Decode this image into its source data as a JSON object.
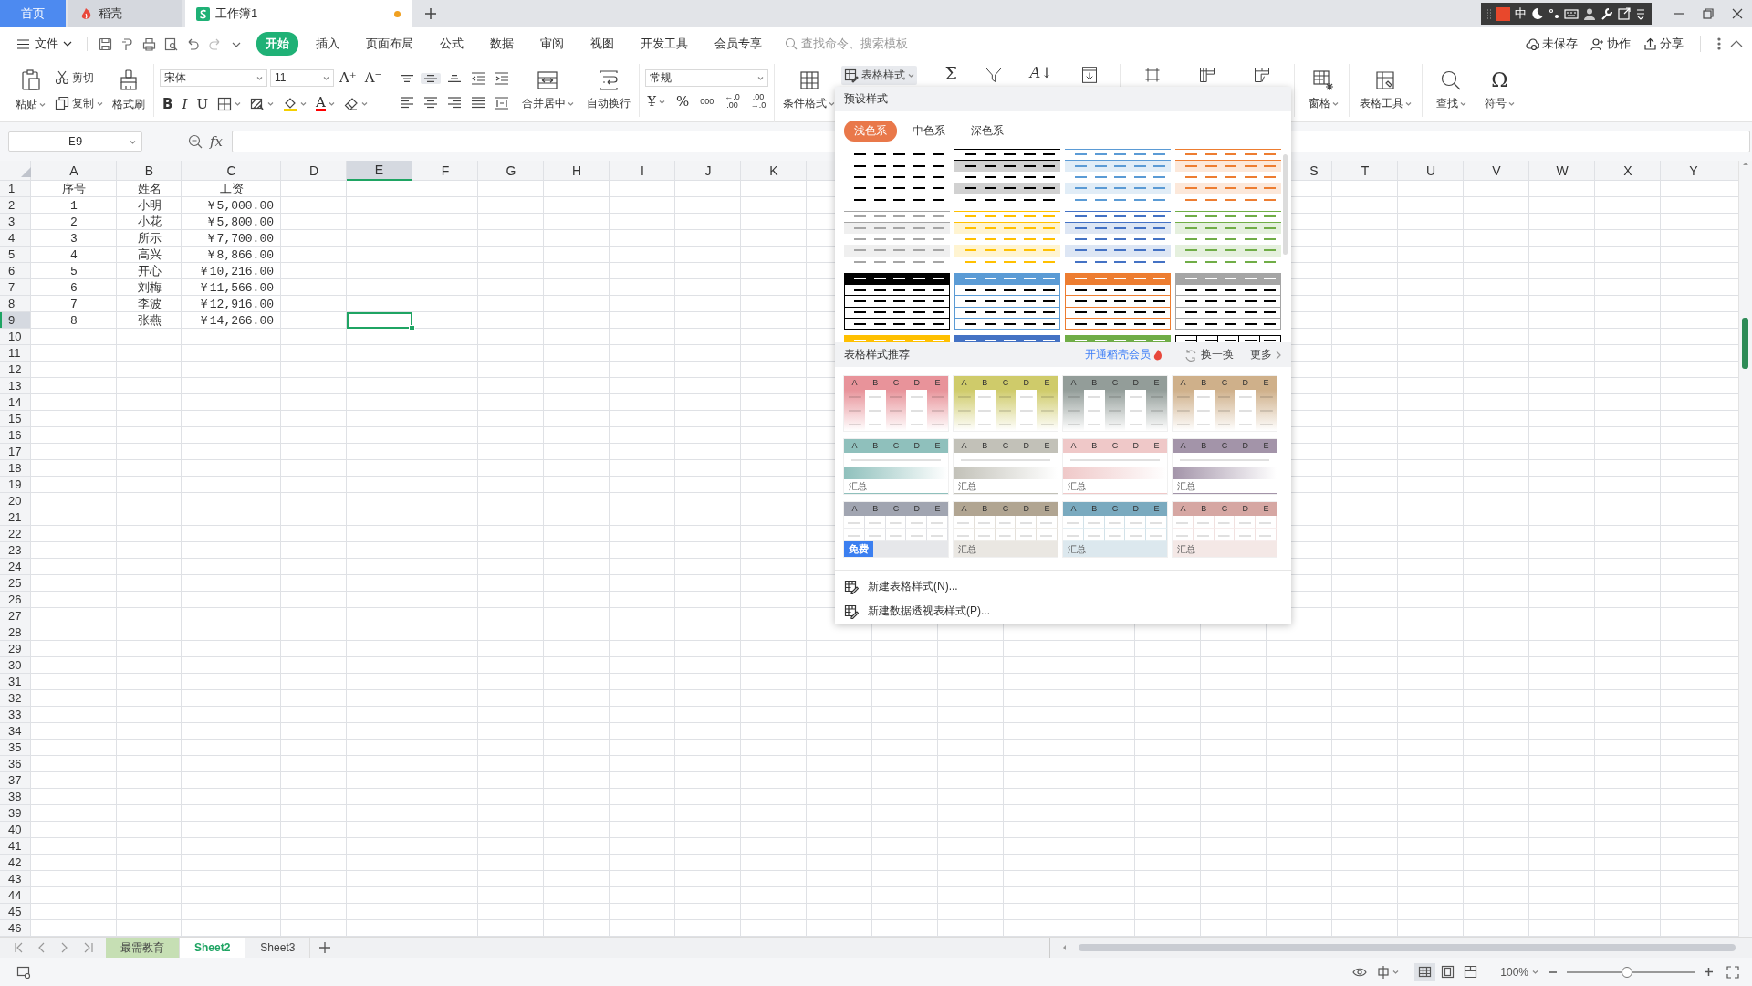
{
  "title_bar": {
    "tabs": [
      {
        "label": "首页",
        "kind": "home",
        "selected": false
      },
      {
        "label": "稻壳",
        "kind": "docer",
        "selected": false
      },
      {
        "label": "工作簿1",
        "kind": "sheet",
        "selected": true,
        "modified": true
      }
    ],
    "ime": {
      "label": "中"
    }
  },
  "menu_bar": {
    "file": "文件",
    "tabs": [
      {
        "label": "开始",
        "selected": true
      },
      {
        "label": "插入",
        "selected": false
      },
      {
        "label": "页面布局",
        "selected": false
      },
      {
        "label": "公式",
        "selected": false
      },
      {
        "label": "数据",
        "selected": false
      },
      {
        "label": "审阅",
        "selected": false
      },
      {
        "label": "视图",
        "selected": false
      },
      {
        "label": "开发工具",
        "selected": false
      },
      {
        "label": "会员专享",
        "selected": false
      }
    ],
    "search": {
      "placeholder": "查找命令、搜索模板"
    },
    "actions": [
      {
        "label": "未保存",
        "kind": "cloud"
      },
      {
        "label": "协作",
        "kind": "collab"
      },
      {
        "label": "分享",
        "kind": "share"
      }
    ]
  },
  "ribbon": {
    "paste": "粘贴",
    "cut": "剪切",
    "copy": "复制",
    "format_painter": "格式刷",
    "font": "宋体",
    "font_size": "11",
    "grow_font": "A⁺",
    "shrink_font": "A⁻",
    "bold": "B",
    "italic": "I",
    "underline": "U",
    "font_color": {
      "label": "A",
      "color": "#ff0000"
    },
    "align_buttons": [
      {
        "kind": "top",
        "pressed": false
      },
      {
        "kind": "middle",
        "pressed": true
      },
      {
        "kind": "bottom",
        "pressed": false
      }
    ],
    "merge": "合并居中",
    "wrap": "自动换行",
    "number_format": "常规",
    "currency": "¥",
    "percent": "%",
    "thousands": "000",
    "increase_decimal": [
      "←.0",
      ".00"
    ],
    "decrease_decimal": [
      ".00",
      "→.0"
    ],
    "conditional_format": "条件格式",
    "table_style": {
      "label": "表格样式",
      "pressed": true
    },
    "sum": "Σ",
    "sort": "A↓",
    "freeze": "窗格",
    "table_tools": "表格工具",
    "find": "查找",
    "symbol_icon": "Ω",
    "symbol": "符号"
  },
  "formula_bar": {
    "name_box": "E9",
    "fx": "fx"
  },
  "grid": {
    "columns": [
      {
        "label": "A",
        "selected": false
      },
      {
        "label": "B",
        "selected": false
      },
      {
        "label": "C",
        "selected": false
      },
      {
        "label": "D",
        "selected": false
      },
      {
        "label": "E",
        "selected": true
      },
      {
        "label": "F",
        "selected": false
      },
      {
        "label": "G",
        "selected": false
      },
      {
        "label": "H",
        "selected": false
      },
      {
        "label": "I",
        "selected": false
      },
      {
        "label": "J",
        "selected": false
      },
      {
        "label": "K",
        "selected": false
      },
      {
        "kind": "covered"
      },
      {
        "kind": "covered"
      },
      {
        "kind": "covered"
      },
      {
        "kind": "covered"
      },
      {
        "kind": "covered"
      },
      {
        "kind": "covered"
      },
      {
        "kind": "covered"
      },
      {
        "label": "S",
        "selected": false
      },
      {
        "label": "T",
        "selected": false
      },
      {
        "label": "U",
        "selected": false
      },
      {
        "label": "V",
        "selected": false
      },
      {
        "label": "W",
        "selected": false
      },
      {
        "label": "X",
        "selected": false
      },
      {
        "label": "Y",
        "selected": false
      }
    ],
    "rows": [
      {
        "number": "1",
        "selected": false,
        "kind": "header",
        "cells": [
          "序号",
          "姓名",
          "工资"
        ]
      },
      {
        "number": "2",
        "selected": false,
        "cells": [
          "1",
          "小明",
          "￥5,000.00"
        ]
      },
      {
        "number": "3",
        "selected": false,
        "cells": [
          "2",
          "小花",
          "￥5,800.00"
        ]
      },
      {
        "number": "4",
        "selected": false,
        "cells": [
          "3",
          "所示",
          "￥7,700.00"
        ]
      },
      {
        "number": "5",
        "selected": false,
        "cells": [
          "4",
          "高兴",
          "￥8,866.00"
        ]
      },
      {
        "number": "6",
        "selected": false,
        "cells": [
          "5",
          "开心",
          "￥10,216.00"
        ]
      },
      {
        "number": "7",
        "selected": false,
        "cells": [
          "6",
          "刘梅",
          "￥11,566.00"
        ]
      },
      {
        "number": "8",
        "selected": false,
        "cells": [
          "7",
          "李波",
          "￥12,916.00"
        ]
      },
      {
        "number": "9",
        "selected": true,
        "cells": [
          "8",
          "张燕",
          "￥14,266.00"
        ]
      },
      {
        "number": "10",
        "selected": false
      },
      {
        "number": "11",
        "selected": false
      },
      {
        "number": "12",
        "selected": false
      },
      {
        "number": "13",
        "selected": false
      },
      {
        "number": "14",
        "selected": false
      },
      {
        "number": "15",
        "selected": false
      },
      {
        "number": "16",
        "selected": false
      },
      {
        "number": "17",
        "selected": false
      },
      {
        "number": "18",
        "selected": false
      },
      {
        "number": "19",
        "selected": false
      },
      {
        "number": "20",
        "selected": false
      },
      {
        "number": "21",
        "selected": false
      },
      {
        "number": "22",
        "selected": false
      },
      {
        "number": "23",
        "selected": false
      },
      {
        "number": "24",
        "selected": false
      },
      {
        "number": "25",
        "selected": false
      },
      {
        "number": "26",
        "selected": false
      },
      {
        "number": "27",
        "selected": false
      },
      {
        "number": "28",
        "selected": false
      },
      {
        "number": "29",
        "selected": false
      },
      {
        "number": "30",
        "selected": false
      },
      {
        "number": "31",
        "selected": false
      },
      {
        "number": "32",
        "selected": false
      },
      {
        "number": "33",
        "selected": false
      },
      {
        "number": "34",
        "selected": false
      },
      {
        "number": "35",
        "selected": false
      },
      {
        "number": "36",
        "selected": false
      },
      {
        "number": "37",
        "selected": false
      },
      {
        "number": "38",
        "selected": false
      },
      {
        "number": "39",
        "selected": false
      },
      {
        "number": "40",
        "selected": false
      },
      {
        "number": "41",
        "selected": false
      },
      {
        "number": "42",
        "selected": false
      },
      {
        "number": "43",
        "selected": false
      },
      {
        "number": "44",
        "selected": false
      },
      {
        "number": "45",
        "selected": false
      },
      {
        "number": "46",
        "selected": false
      }
    ]
  },
  "style_menu": {
    "title": "预设样式",
    "tabs": [
      {
        "label": "浅色系",
        "selected": true
      },
      {
        "label": "中色系",
        "selected": false
      },
      {
        "label": "深色系",
        "selected": false
      }
    ],
    "presets": [
      {
        "kind": "plain",
        "color": "#000000"
      },
      {
        "kind": "banded",
        "color": "#000000"
      },
      {
        "kind": "banded",
        "color": "#5b9bd5"
      },
      {
        "kind": "banded",
        "color": "#ed7d31"
      },
      {
        "kind": "banded",
        "color": "#a5a5a5"
      },
      {
        "kind": "banded",
        "color": "#ffc000"
      },
      {
        "kind": "banded",
        "color": "#4472c4"
      },
      {
        "kind": "banded",
        "color": "#70ad47"
      },
      {
        "kind": "header",
        "color": "#000000"
      },
      {
        "kind": "header",
        "color": "#5b9bd5"
      },
      {
        "kind": "header",
        "color": "#ed7d31"
      },
      {
        "kind": "header",
        "color": "#a5a5a5"
      },
      {
        "kind": "header",
        "color": "#ffc000"
      },
      {
        "kind": "header",
        "color": "#4472c4"
      },
      {
        "kind": "header",
        "color": "#70ad47"
      },
      {
        "kind": "grid",
        "color": "#000000"
      }
    ],
    "recommend": {
      "title": "表格样式推荐",
      "vip_link": "开通稻壳会员",
      "refresh": "换一换",
      "more": "更多"
    },
    "templates": [
      {
        "kind": "columns",
        "color": "#e8939a",
        "headers": [
          "A",
          "B",
          "C",
          "D",
          "E"
        ]
      },
      {
        "kind": "columns",
        "color": "#cfcb6a",
        "headers": [
          "A",
          "B",
          "C",
          "D",
          "E"
        ]
      },
      {
        "kind": "columns",
        "color": "#939d99",
        "headers": [
          "A",
          "B",
          "C",
          "D",
          "E"
        ]
      },
      {
        "kind": "columns",
        "color": "#cfb08a",
        "headers": [
          "A",
          "B",
          "C",
          "D",
          "E"
        ]
      },
      {
        "kind": "gradient",
        "color": "#8fc0bc",
        "headers": [
          "A",
          "B",
          "C",
          "D",
          "E"
        ],
        "footer": "汇总"
      },
      {
        "kind": "gradient",
        "color": "#c2c1b8",
        "headers": [
          "A",
          "B",
          "C",
          "D",
          "E"
        ],
        "footer": "汇总"
      },
      {
        "kind": "gradient",
        "color": "#efc8c8",
        "headers": [
          "A",
          "B",
          "C",
          "D",
          "E"
        ],
        "footer": "汇总"
      },
      {
        "kind": "gradient",
        "color": "#a394a9",
        "headers": [
          "A",
          "B",
          "C",
          "D",
          "E"
        ],
        "footer": "汇总"
      },
      {
        "kind": "grid",
        "color": "#a1a5b1",
        "headers": [
          "A",
          "B",
          "C",
          "D",
          "E"
        ],
        "badge": "免费"
      },
      {
        "kind": "grid",
        "color": "#b1a592",
        "headers": [
          "A",
          "B",
          "C",
          "D",
          "E"
        ],
        "footer": "汇总"
      },
      {
        "kind": "grid",
        "color": "#7aaabf",
        "headers": [
          "A",
          "B",
          "C",
          "D",
          "E"
        ],
        "footer": "汇总"
      },
      {
        "kind": "grid",
        "color": "#d6a7a3",
        "headers": [
          "A",
          "B",
          "C",
          "D",
          "E"
        ],
        "footer": "汇总"
      }
    ],
    "commands": [
      {
        "label": "新建表格样式(N)..."
      },
      {
        "label": "新建数据透视表样式(P)..."
      }
    ]
  },
  "sheet_bar": {
    "sheets": [
      {
        "label": "最需教育",
        "selected": false,
        "color": "#c6dfb4"
      },
      {
        "label": "Sheet2",
        "selected": true
      },
      {
        "label": "Sheet3",
        "selected": false
      }
    ]
  },
  "status_bar": {
    "views": [
      {
        "kind": "normal",
        "selected": true
      },
      {
        "kind": "page_layout",
        "selected": false
      },
      {
        "kind": "page_break",
        "selected": false
      }
    ],
    "zoom": "100%",
    "zoom_slider": {
      "level": 0.47
    }
  }
}
